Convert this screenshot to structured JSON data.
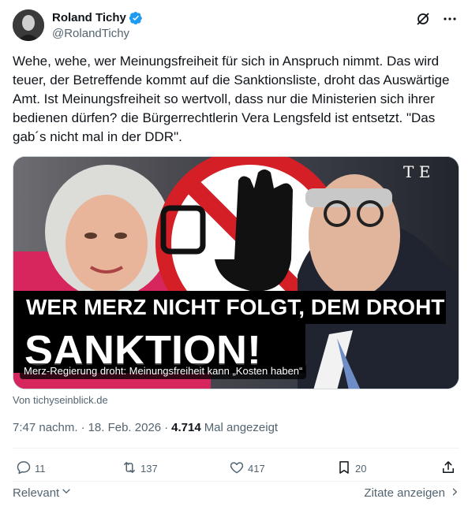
{
  "author": {
    "display_name": "Roland Tichy",
    "handle": "@RolandTichy"
  },
  "tweet": {
    "text": "Wehe, wehe, wer Meinungsfreiheit für sich in Anspruch nimmt. Das wird teuer, der Betreffende kommt auf die Sanktionsliste, droht das Auswärtige Amt. Ist Meinungsfreiheit so wertvoll, dass nur die Ministerien sich ihrer bedienen dürfen? die Bürgerrechtlerin Vera Lengsfeld ist entsetzt. \"Das gab´s nicht mal in der DDR\"."
  },
  "card": {
    "logo_text": "T E",
    "headline_line1": "WER MERZ NICHT FOLGT, DEM DROHT",
    "headline_line2": "SANKTION!",
    "caption": "Merz-Regierung droht: Meinungsfreiheit kann „Kosten haben“",
    "source": "Von tichyseinblick.de"
  },
  "meta": {
    "time": "7:47 nachm.",
    "separator": "·",
    "date": "18. Feb. 2026",
    "views_count": "4.714",
    "views_label": "Mal angezeigt"
  },
  "actions": {
    "replies": "11",
    "reposts": "137",
    "likes": "417",
    "bookmarks": "20"
  },
  "footer": {
    "sort_label": "Relevant",
    "quotes_label": "Zitate anzeigen"
  },
  "colors": {
    "text": "#0f1419",
    "secondary": "#536471",
    "verified": "#1d9bf0",
    "divider": "#eff3f4"
  }
}
